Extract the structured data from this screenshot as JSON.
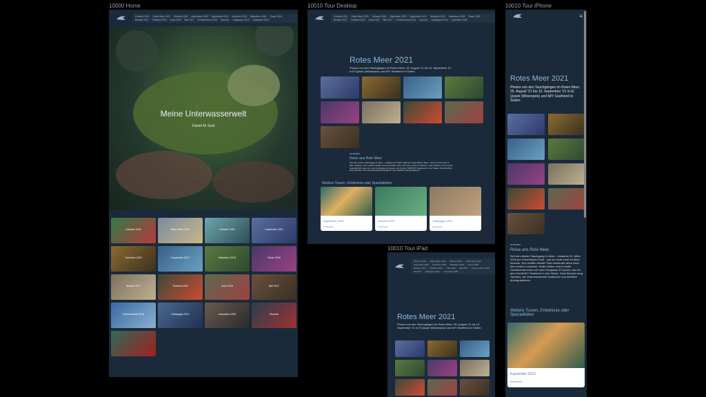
{
  "labels": {
    "home": "10000 Home",
    "desktop": "10010 Tour Desktop",
    "iphone": "10010 Tour iPhone",
    "ipad": "10010 Tour iPad"
  },
  "nav": {
    "links": [
      "Schweiz 2021",
      "Rotes Meer 2021",
      "Schweiz 2020",
      "Kapverden 2020",
      "Kapverden 2019",
      "Sardinien 2019",
      "Malediven 2018",
      "Oman 2018",
      "Bonaire 2017",
      "Thailand 2016",
      "Kuba 2016",
      "Bali 2017",
      "Fuerteventura 2015",
      "Tauchen",
      "Galapagos 2012",
      "Australien 2009"
    ]
  },
  "home": {
    "hero_title": "Meine Unterwasserwelt",
    "hero_subtitle": "Daniel M. Graf",
    "tiles": [
      "Schweiz 2021",
      "Rotes Meer 2021",
      "Schweiz 2020",
      "Kapverden 2020",
      "Sardinien 2019",
      "Kapverden 2019",
      "Malediven 2018",
      "Oman 2018",
      "Bonaire 2017",
      "Thailand 2016",
      "Kuba 2016",
      "Bali 2017",
      "Fuerteventura 2015",
      "Galapagos 2012",
      "Australien 2009",
      "Tauchen",
      ""
    ]
  },
  "tour": {
    "title": "Rotes Meer 2021",
    "intro": "Photos von den Tauchgängen im Roten Meer, 26. August '21 bis 10. September '21 in El Quseir (Mövenpick) und M/Y Seafriend in Süden.",
    "date": "23.08.2021",
    "story_title": "Reise ans Rote Meer",
    "story_text": "Seit dem letzten Tauchgang im Meer - notabene 20. März 2020 am Great Barrier Reef - war ich nicht mehr im Meer tauchen. Nun endlich wieder! Fast einenhalb Jahre nach dem ersten Lockdown. Guten Mutes und in bester Gesellschaft reisen wir nach Hurghada, El Quseir und mit dem Schiff M/Y Seafriend in den Süden. Zwei Wochen lang Tauchen, die Unterwasserwelt bestaunen und natürlich photographieren.",
    "more_title": "Weitere Touren, Erlebnisse oder Spezialitäten",
    "cards": [
      {
        "title": "Kapverden 2019",
        "link": "Anschauen"
      },
      {
        "title": "Schweiz 2021",
        "link": "Anschauen"
      },
      {
        "title": "Galapagos 2012",
        "link": "Anschauen"
      }
    ]
  },
  "icons": {
    "menu": "hamburger-menu-icon",
    "logo": "shark-logo-icon"
  }
}
